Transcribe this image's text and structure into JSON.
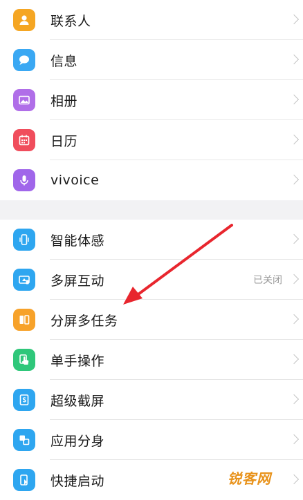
{
  "group1": [
    {
      "label": "联系人",
      "icon": "contacts-icon",
      "color": "#f5a623"
    },
    {
      "label": "信息",
      "icon": "message-icon",
      "color": "#3aa8f3"
    },
    {
      "label": "相册",
      "icon": "gallery-icon",
      "color": "#b06ee8"
    },
    {
      "label": "日历",
      "icon": "calendar-icon",
      "color": "#f04d5c"
    },
    {
      "label": "vivoice",
      "icon": "microphone-icon",
      "color": "#a066ea"
    }
  ],
  "group2": [
    {
      "label": "智能体感",
      "icon": "motion-phone-icon",
      "color": "#2ea6f0",
      "status": ""
    },
    {
      "label": "多屏互动",
      "icon": "multiscreen-icon",
      "color": "#2ea6f0",
      "status": "已关闭"
    },
    {
      "label": "分屏多任务",
      "icon": "split-screen-icon",
      "color": "#f7a22a",
      "status": ""
    },
    {
      "label": "单手操作",
      "icon": "one-hand-icon",
      "color": "#2fc77a",
      "status": ""
    },
    {
      "label": "超级截屏",
      "icon": "screenshot-icon",
      "color": "#2ea6f0",
      "status": ""
    },
    {
      "label": "应用分身",
      "icon": "app-clone-icon",
      "color": "#2ea6f0",
      "status": ""
    },
    {
      "label": "快捷启动",
      "icon": "quick-launch-icon",
      "color": "#2ea6f0",
      "status": ""
    }
  ],
  "watermark": "锐客网",
  "colors": {
    "arrow": "#e8262e",
    "divider": "#e6e6e6",
    "section_bg": "#f2f2f4"
  }
}
